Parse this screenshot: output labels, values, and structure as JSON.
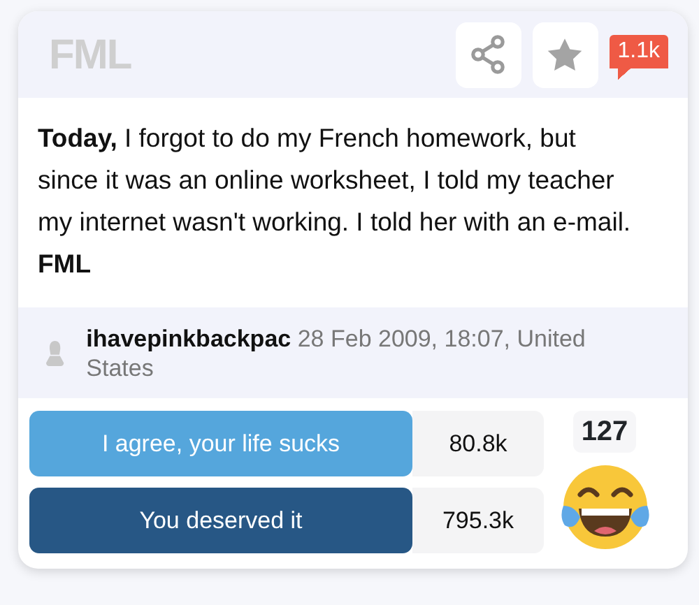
{
  "header": {
    "logo": "FML",
    "comment_count": "1.1k"
  },
  "story": {
    "text": "**Today,** I forgot to do my French homework, but since it was an online worksheet, I told my teacher my internet wasn't working. I told her with an e-mail. **FML**"
  },
  "meta": {
    "author": "ihavepinkbackpac",
    "date_place": "28 Feb 2009, 18:07, United States"
  },
  "votes": [
    {
      "label": "I agree, your life sucks",
      "count": "80.8k",
      "color": "#55a6dc"
    },
    {
      "label": "You deserved it",
      "count": "795.3k",
      "color": "#275785"
    }
  ],
  "reaction": {
    "count": "127"
  }
}
